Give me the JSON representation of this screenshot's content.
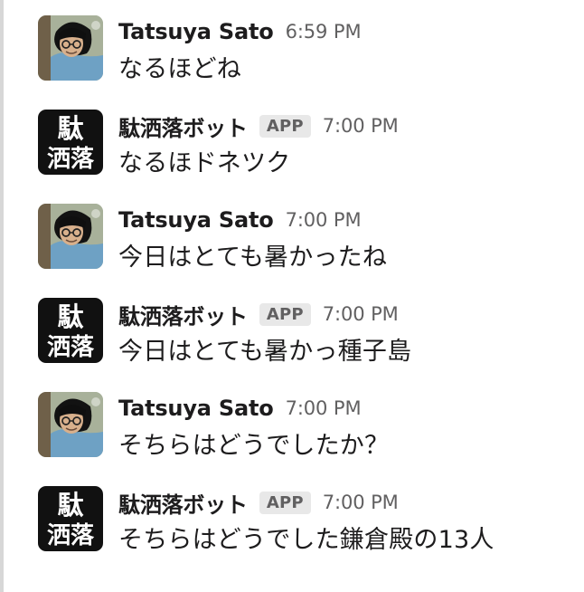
{
  "messages": [
    {
      "sender": "Tatsuya Sato",
      "is_bot": false,
      "time": "6:59 PM",
      "text": "なるほどね",
      "avatar": "user-photo-avatar"
    },
    {
      "sender": "駄洒落ボット",
      "is_bot": true,
      "app_badge": "APP",
      "time": "7:00 PM",
      "text": "なるほドネツク",
      "avatar": {
        "top": "駄",
        "bottom": "洒落"
      }
    },
    {
      "sender": "Tatsuya Sato",
      "is_bot": false,
      "time": "7:00 PM",
      "text": "今日はとても暑かったね",
      "avatar": "user-photo-avatar"
    },
    {
      "sender": "駄洒落ボット",
      "is_bot": true,
      "app_badge": "APP",
      "time": "7:00 PM",
      "text": "今日はとても暑かっ種子島",
      "avatar": {
        "top": "駄",
        "bottom": "洒落"
      }
    },
    {
      "sender": "Tatsuya Sato",
      "is_bot": false,
      "time": "7:00 PM",
      "text": "そちらはどうでしたか？",
      "avatar": "user-photo-avatar"
    },
    {
      "sender": "駄洒落ボット",
      "is_bot": true,
      "app_badge": "APP",
      "time": "7:00 PM",
      "text": "そちらはどうでした鎌倉殿の13人",
      "avatar": {
        "top": "駄",
        "bottom": "洒落"
      }
    }
  ],
  "colors": {
    "text_primary": "#1d1c1d",
    "text_secondary": "#616061",
    "badge_background": "#e8e8e8",
    "bot_avatar_background": "#111111"
  }
}
